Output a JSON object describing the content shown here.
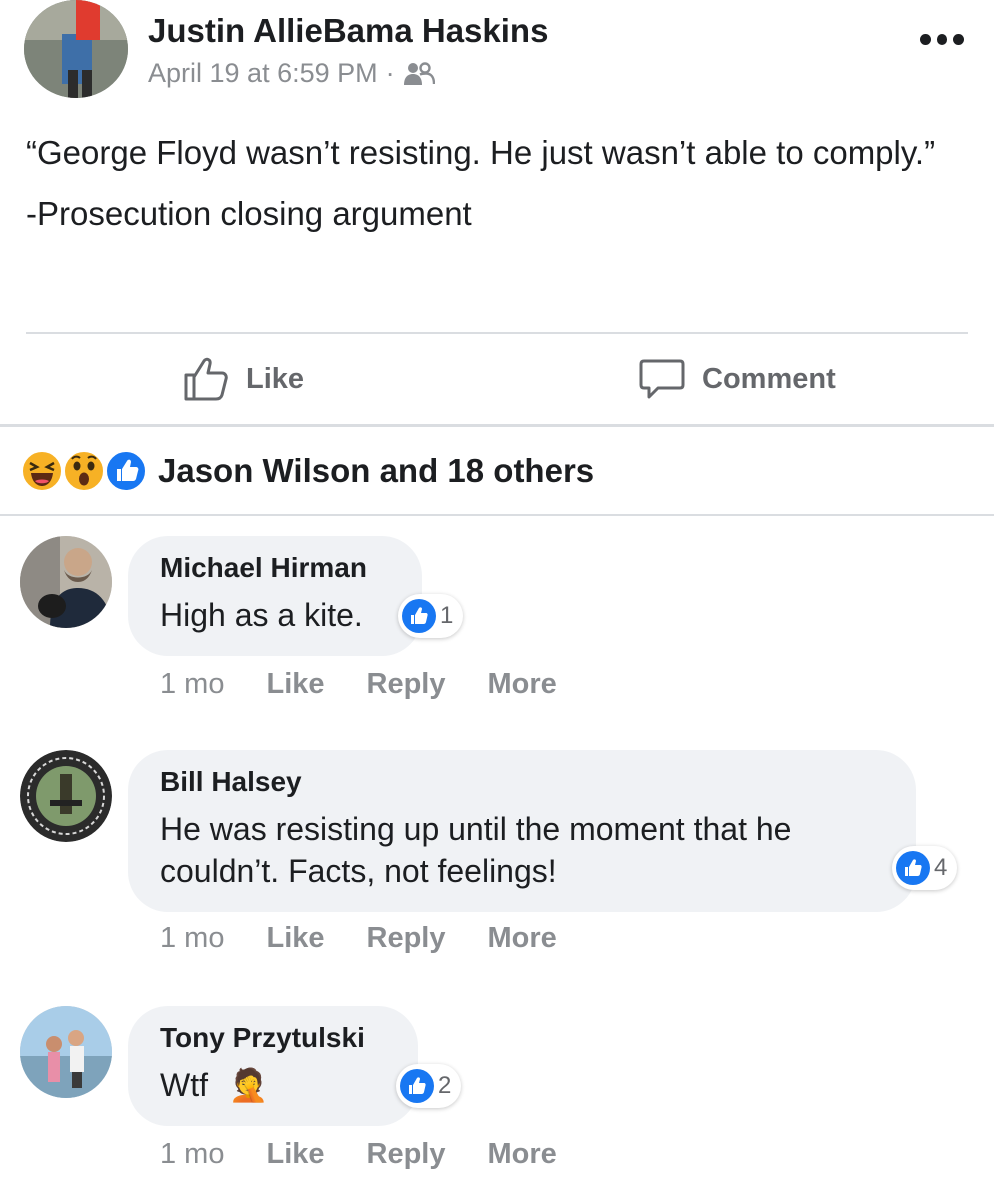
{
  "post": {
    "author": "Justin AllieBama Haskins",
    "timestamp": "April 19 at 6:59 PM",
    "separator": "·",
    "audience_icon": "friends-icon",
    "more_icon": "more-dots-icon",
    "text_line1": "“George Floyd wasn’t resisting. He just wasn’t able to comply.”",
    "text_line2": "-Prosecution closing argument"
  },
  "actions": {
    "like_label": "Like",
    "comment_label": "Comment"
  },
  "reactions": {
    "icons": [
      "haha-icon",
      "wow-icon",
      "like-icon"
    ],
    "summary": "Jason Wilson and 18 others"
  },
  "comments": [
    {
      "name": "Michael Hirman",
      "text": "High as a kite.",
      "reaction_count": "1",
      "age": "1 mo",
      "like": "Like",
      "reply": "Reply",
      "more": "More"
    },
    {
      "name": "Bill Halsey",
      "text": "He was resisting up until the moment that he couldn’t. Facts, not feelings!",
      "reaction_count": "4",
      "age": "1 mo",
      "like": "Like",
      "reply": "Reply",
      "more": "More"
    },
    {
      "name": "Tony Przytulski",
      "text": "Wtf",
      "emoji": "🤦",
      "reaction_count": "2",
      "age": "1 mo",
      "like": "Like",
      "reply": "Reply",
      "more": "More"
    }
  ],
  "colors": {
    "text": "#1c1e21",
    "muted": "#8a8d91",
    "bubble": "#f0f2f5",
    "like_blue": "#1877f2",
    "reaction_yellow": "#f7b125",
    "divider": "#dadde1"
  }
}
